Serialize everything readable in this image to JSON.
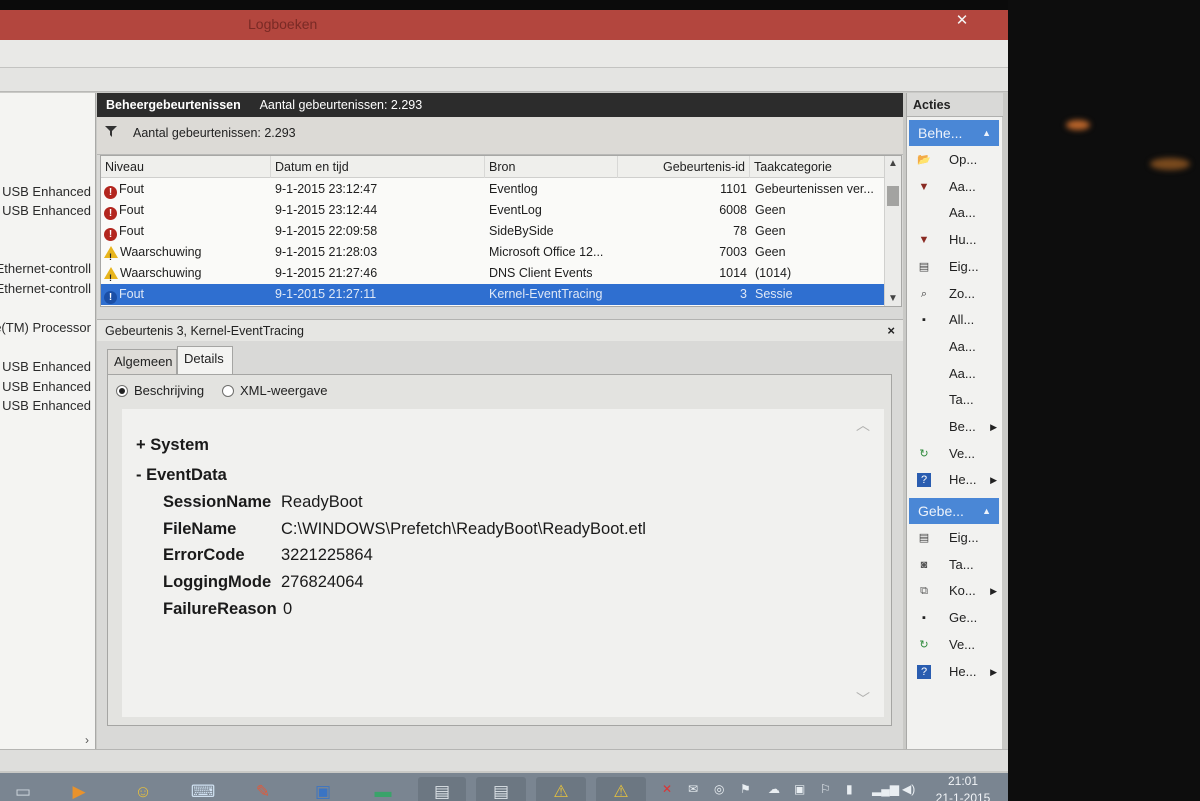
{
  "window": {
    "title": "Logboeken",
    "close_label": "✕"
  },
  "tree": {
    "items": [
      {
        "label": "USB Enhanced"
      },
      {
        "label": "USB Enhanced"
      },
      {
        "label": "Ethernet-controll"
      },
      {
        "label": "Ethernet-controll"
      },
      {
        "label": "e(TM) Processor"
      },
      {
        "label": "y USB Enhanced"
      },
      {
        "label": "y USB Enhanced"
      },
      {
        "label": "y USB Enhanced"
      }
    ],
    "scroll_right": "›"
  },
  "panel_header": {
    "title": "Beheergebeurtenissen",
    "count": "Aantal gebeurtenissen: 2.293"
  },
  "filter": {
    "text": "Aantal gebeurtenissen: 2.293"
  },
  "grid": {
    "columns": [
      "Niveau",
      "Datum en tijd",
      "Bron",
      "Gebeurtenis-id",
      "Taakcategorie"
    ],
    "rows": [
      {
        "level": "Fout",
        "kind": "err",
        "datetime": "9-1-2015 23:12:47",
        "source": "Eventlog",
        "id": "1101",
        "category": "Gebeurtenissen ver..."
      },
      {
        "level": "Fout",
        "kind": "err",
        "datetime": "9-1-2015 23:12:44",
        "source": "EventLog",
        "id": "6008",
        "category": "Geen"
      },
      {
        "level": "Fout",
        "kind": "err",
        "datetime": "9-1-2015 22:09:58",
        "source": "SideBySide",
        "id": "78",
        "category": "Geen"
      },
      {
        "level": "Waarschuwing",
        "kind": "warn",
        "datetime": "9-1-2015 21:28:03",
        "source": "Microsoft Office 12...",
        "id": "7003",
        "category": "Geen"
      },
      {
        "level": "Waarschuwing",
        "kind": "warn",
        "datetime": "9-1-2015 21:27:46",
        "source": "DNS Client Events",
        "id": "1014",
        "category": "(1014)"
      },
      {
        "level": "Fout",
        "kind": "info",
        "datetime": "9-1-2015 21:27:11",
        "source": "Kernel-EventTracing",
        "id": "3",
        "category": "Sessie",
        "selected": true
      }
    ]
  },
  "detail": {
    "title": "Gebeurtenis 3, Kernel-EventTracing",
    "close_label": "×",
    "tabs": [
      "Algemeen",
      "Details"
    ],
    "radios": [
      "Beschrijving",
      "XML-weergave"
    ],
    "xml": {
      "system": "+ System",
      "eventdata": "- EventData",
      "fields": [
        {
          "key": "SessionName",
          "value": "ReadyBoot"
        },
        {
          "key": "FileName",
          "value": "C:\\WINDOWS\\Prefetch\\ReadyBoot\\ReadyBoot.etl"
        },
        {
          "key": "ErrorCode",
          "value": "3221225864"
        },
        {
          "key": "LoggingMode",
          "value": "276824064"
        },
        {
          "key": "FailureReason",
          "value": "0"
        }
      ]
    }
  },
  "actions": {
    "header": "Acties",
    "group1": "Behe...",
    "items1": [
      {
        "label": "Op...",
        "icon": "folder-icon"
      },
      {
        "label": "Aa...",
        "icon": "filter-icon"
      },
      {
        "label": "Aa...",
        "icon": ""
      },
      {
        "label": "Hu...",
        "icon": "filter-icon"
      },
      {
        "label": "Eig...",
        "icon": "properties-icon"
      },
      {
        "label": "Zo...",
        "icon": "find-icon"
      },
      {
        "label": "All...",
        "icon": "save-icon"
      },
      {
        "label": "Aa...",
        "icon": ""
      },
      {
        "label": "Aa...",
        "icon": ""
      },
      {
        "label": "Ta...",
        "icon": ""
      },
      {
        "label": "Be...",
        "icon": "",
        "submenu": true
      },
      {
        "label": "Ve...",
        "icon": "refresh-icon"
      },
      {
        "label": "He...",
        "icon": "help-icon",
        "submenu": true
      }
    ],
    "group2": "Gebe...",
    "items2": [
      {
        "label": "Eig...",
        "icon": "properties-icon"
      },
      {
        "label": "Ta...",
        "icon": "task-icon"
      },
      {
        "label": "Ko...",
        "icon": "copy-icon",
        "submenu": true
      },
      {
        "label": "Ge...",
        "icon": "save-icon"
      },
      {
        "label": "Ve...",
        "icon": "refresh-icon"
      },
      {
        "label": "He...",
        "icon": "help-icon",
        "submenu": true
      }
    ]
  },
  "clock": {
    "time": "21:01",
    "date": "21-1-2015"
  }
}
